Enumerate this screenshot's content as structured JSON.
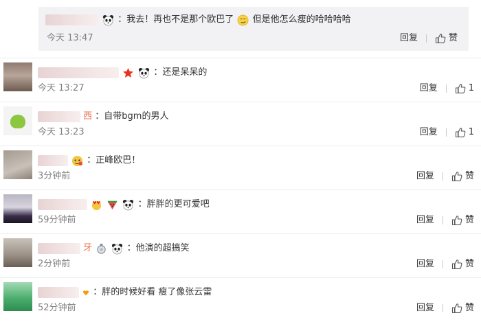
{
  "nested_reply": {
    "text": "：我去！再也不是那个欧巴了",
    "text_after": "但是他怎么瘦的哈哈哈哈",
    "time": "今天 13:47",
    "reply_label": "回复",
    "like_label": "赞"
  },
  "comments": [
    {
      "text": "：还是呆呆的",
      "time": "今天 13:27",
      "reply_label": "回复",
      "like_label": "1"
    },
    {
      "name_tail": "西",
      "text": "：自带bgm的男人",
      "time": "今天 13:23",
      "reply_label": "回复",
      "like_label": "1"
    },
    {
      "text": "：正峰欧巴！",
      "time": "3分钟前",
      "reply_label": "回复",
      "like_label": "赞"
    },
    {
      "text": "：胖胖的更可爱吧",
      "time": "59分钟前",
      "reply_label": "回复",
      "like_label": "赞"
    },
    {
      "name_tail": "牙",
      "text": "：他演的超搞笑",
      "time": "2分钟前",
      "reply_label": "回复",
      "like_label": "赞"
    },
    {
      "text": "：胖的时候好看 瘦了像张云雷",
      "time": "52分钟前",
      "reply_label": "回复",
      "like_label": "赞"
    }
  ],
  "icons": {
    "like": "thumbs-up-icon",
    "panda": "panda-emoji-icon",
    "star": "star-emoji-icon",
    "smirk": "smirk-emoji-icon",
    "face": "face-emoji-icon",
    "watermelon": "watermelon-emoji-icon",
    "medal": "medal-emoji-icon",
    "heart": "heart-emoji-icon"
  },
  "colors": {
    "text": "#333333",
    "meta": "#808080",
    "reply_bg": "#f2f2f5",
    "star": "#e8341c"
  }
}
